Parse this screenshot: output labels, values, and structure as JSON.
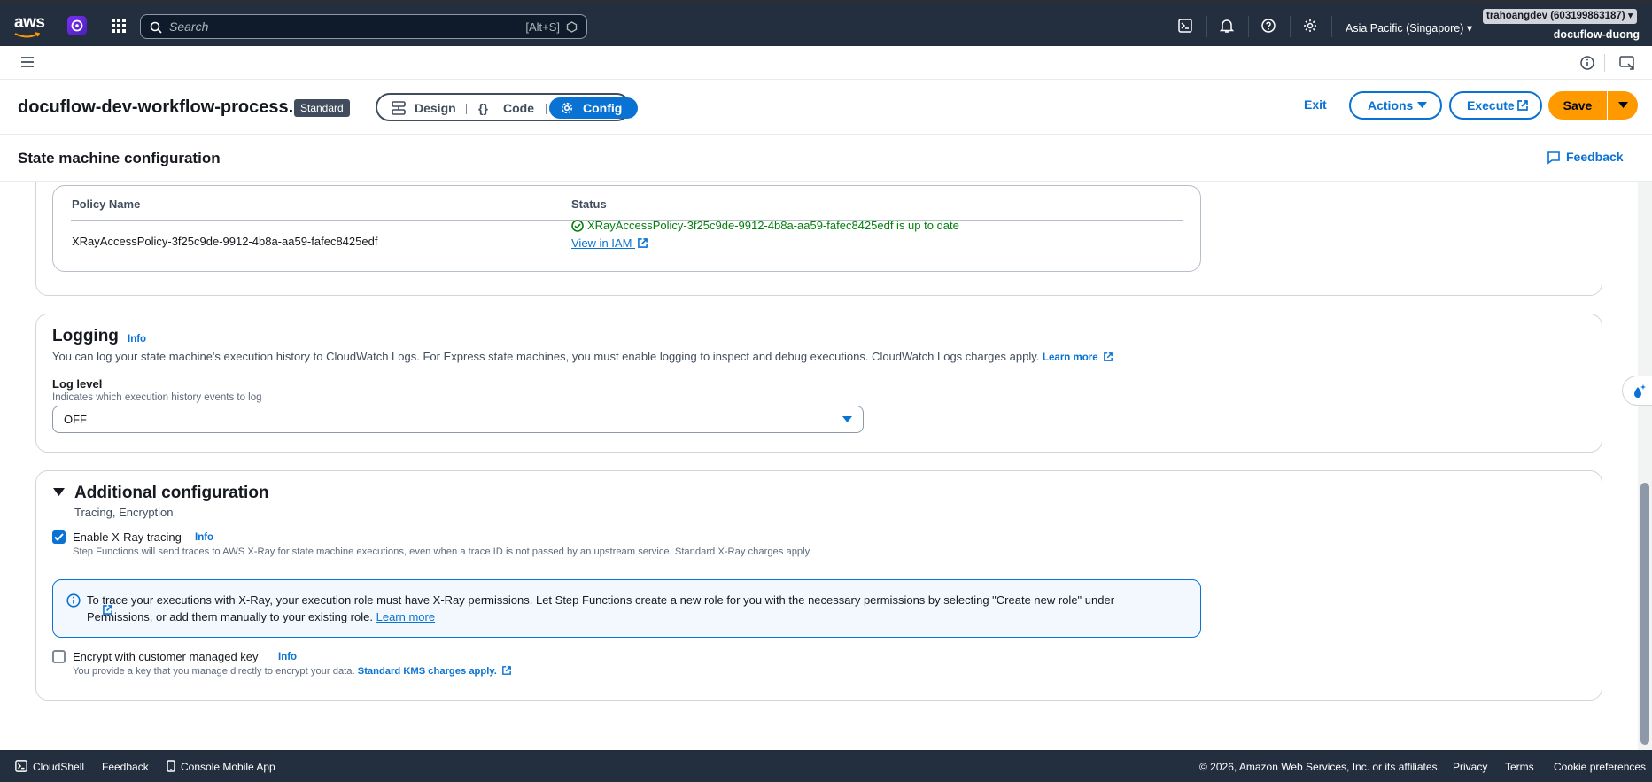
{
  "topnav": {
    "logo_text": "aws",
    "search_placeholder": "Search",
    "search_shortcut": "[Alt+S]",
    "region": "Asia Pacific (Singapore) ▾",
    "account_id_badge": "trahoangdev (603199863187) ▾",
    "account_name": "docuflow-duong"
  },
  "header": {
    "state_machine_name": "docuflow-dev-workflow-process...",
    "type_badge": "Standard",
    "modes": [
      {
        "label": "Design",
        "icon": "design-icon"
      },
      {
        "label": "Code",
        "icon": "braces-icon"
      },
      {
        "label": "Config",
        "icon": "gear-icon",
        "active": true
      }
    ],
    "exit_label": "Exit",
    "actions_label": "Actions",
    "execute_label": "Execute",
    "save_label": "Save"
  },
  "config": {
    "title": "State machine configuration",
    "feedback_label": "Feedback"
  },
  "policy_table": {
    "columns": [
      "Policy Name",
      "Status"
    ],
    "rows": [
      {
        "policy_name": "XRayAccessPolicy-3f25c9de-9912-4b8a-aa59-fafec8425edf",
        "status": "XRayAccessPolicy-3f25c9de-9912-4b8a-aa59-fafec8425edf is up to date",
        "link": "View in IAM"
      }
    ]
  },
  "logging": {
    "title": "Logging",
    "info": "Info",
    "description": "You can log your state machine's execution history to CloudWatch Logs. For Express state machines, you must enable logging to inspect and debug executions. CloudWatch Logs charges apply.",
    "learn_more": "Learn more",
    "log_level_label": "Log level",
    "log_level_hint": "Indicates which execution history events to log",
    "log_level_value": "OFF"
  },
  "additional": {
    "title": "Additional configuration",
    "subtitle": "Tracing, Encryption",
    "xray": {
      "label": "Enable X-Ray tracing",
      "info": "Info",
      "checked": true,
      "description": "Step Functions will send traces to AWS X-Ray for state machine executions, even when a trace ID is not passed by an upstream service. Standard X-Ray charges apply."
    },
    "alert": {
      "text": "To trace your executions with X-Ray, your execution role must have X-Ray permissions. Let Step Functions create a new role for you with the necessary permissions by selecting \"Create new role\" under Permissions, or add them manually to your existing role.",
      "link": "Learn more"
    },
    "kms": {
      "label": "Encrypt with customer managed key",
      "info": "Info",
      "checked": false,
      "description": "You provide a key that you manage directly to encrypt your data.",
      "link": "Standard KMS charges apply."
    }
  },
  "footer": {
    "cloudshell": "CloudShell",
    "feedback": "Feedback",
    "mobile_app": "Console Mobile App",
    "copyright": "© 2026, Amazon Web Services, Inc. or its affiliates.",
    "privacy": "Privacy",
    "terms": "Terms",
    "cookies": "Cookie preferences"
  },
  "colors": {
    "nav_bg": "#232f3e",
    "accent": "#0972d3",
    "save": "#ff9900",
    "success": "#037f0c"
  }
}
